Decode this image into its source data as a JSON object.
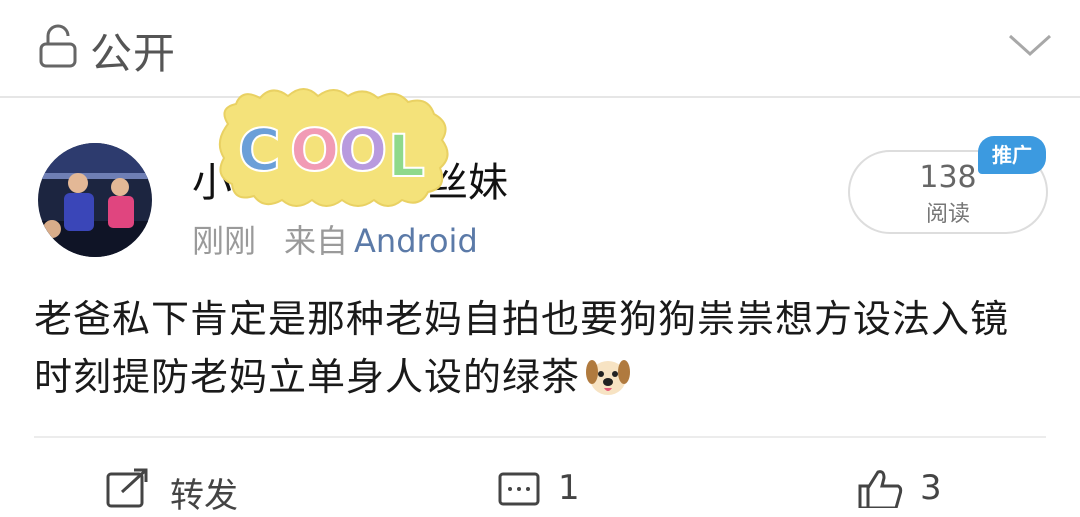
{
  "header": {
    "privacy_label": "公开",
    "lock_icon": "lock-icon",
    "expand_icon": "chevron-down-icon"
  },
  "post": {
    "username": "小●●●●●●●●妹",
    "username_prefix": "小",
    "username_suffix": "丝妹",
    "time": "刚刚",
    "source_prefix": "来自",
    "source": "Android",
    "read_count": "138",
    "read_label": "阅读",
    "promo_badge": "推广",
    "content": "老爸私下肯定是那种老妈自拍也要狗狗祟祟想方设法入镜时刻提防老妈立单身人设的绿茶",
    "emoji": "dog-face-emoji",
    "sticker_text": "COOL"
  },
  "actions": {
    "repost_label": "转发",
    "comment_count": "1",
    "like_count": "3"
  },
  "colors": {
    "link": "#5b7aa8",
    "badge": "#3c9ae0",
    "sticker": "#f4e27a"
  }
}
